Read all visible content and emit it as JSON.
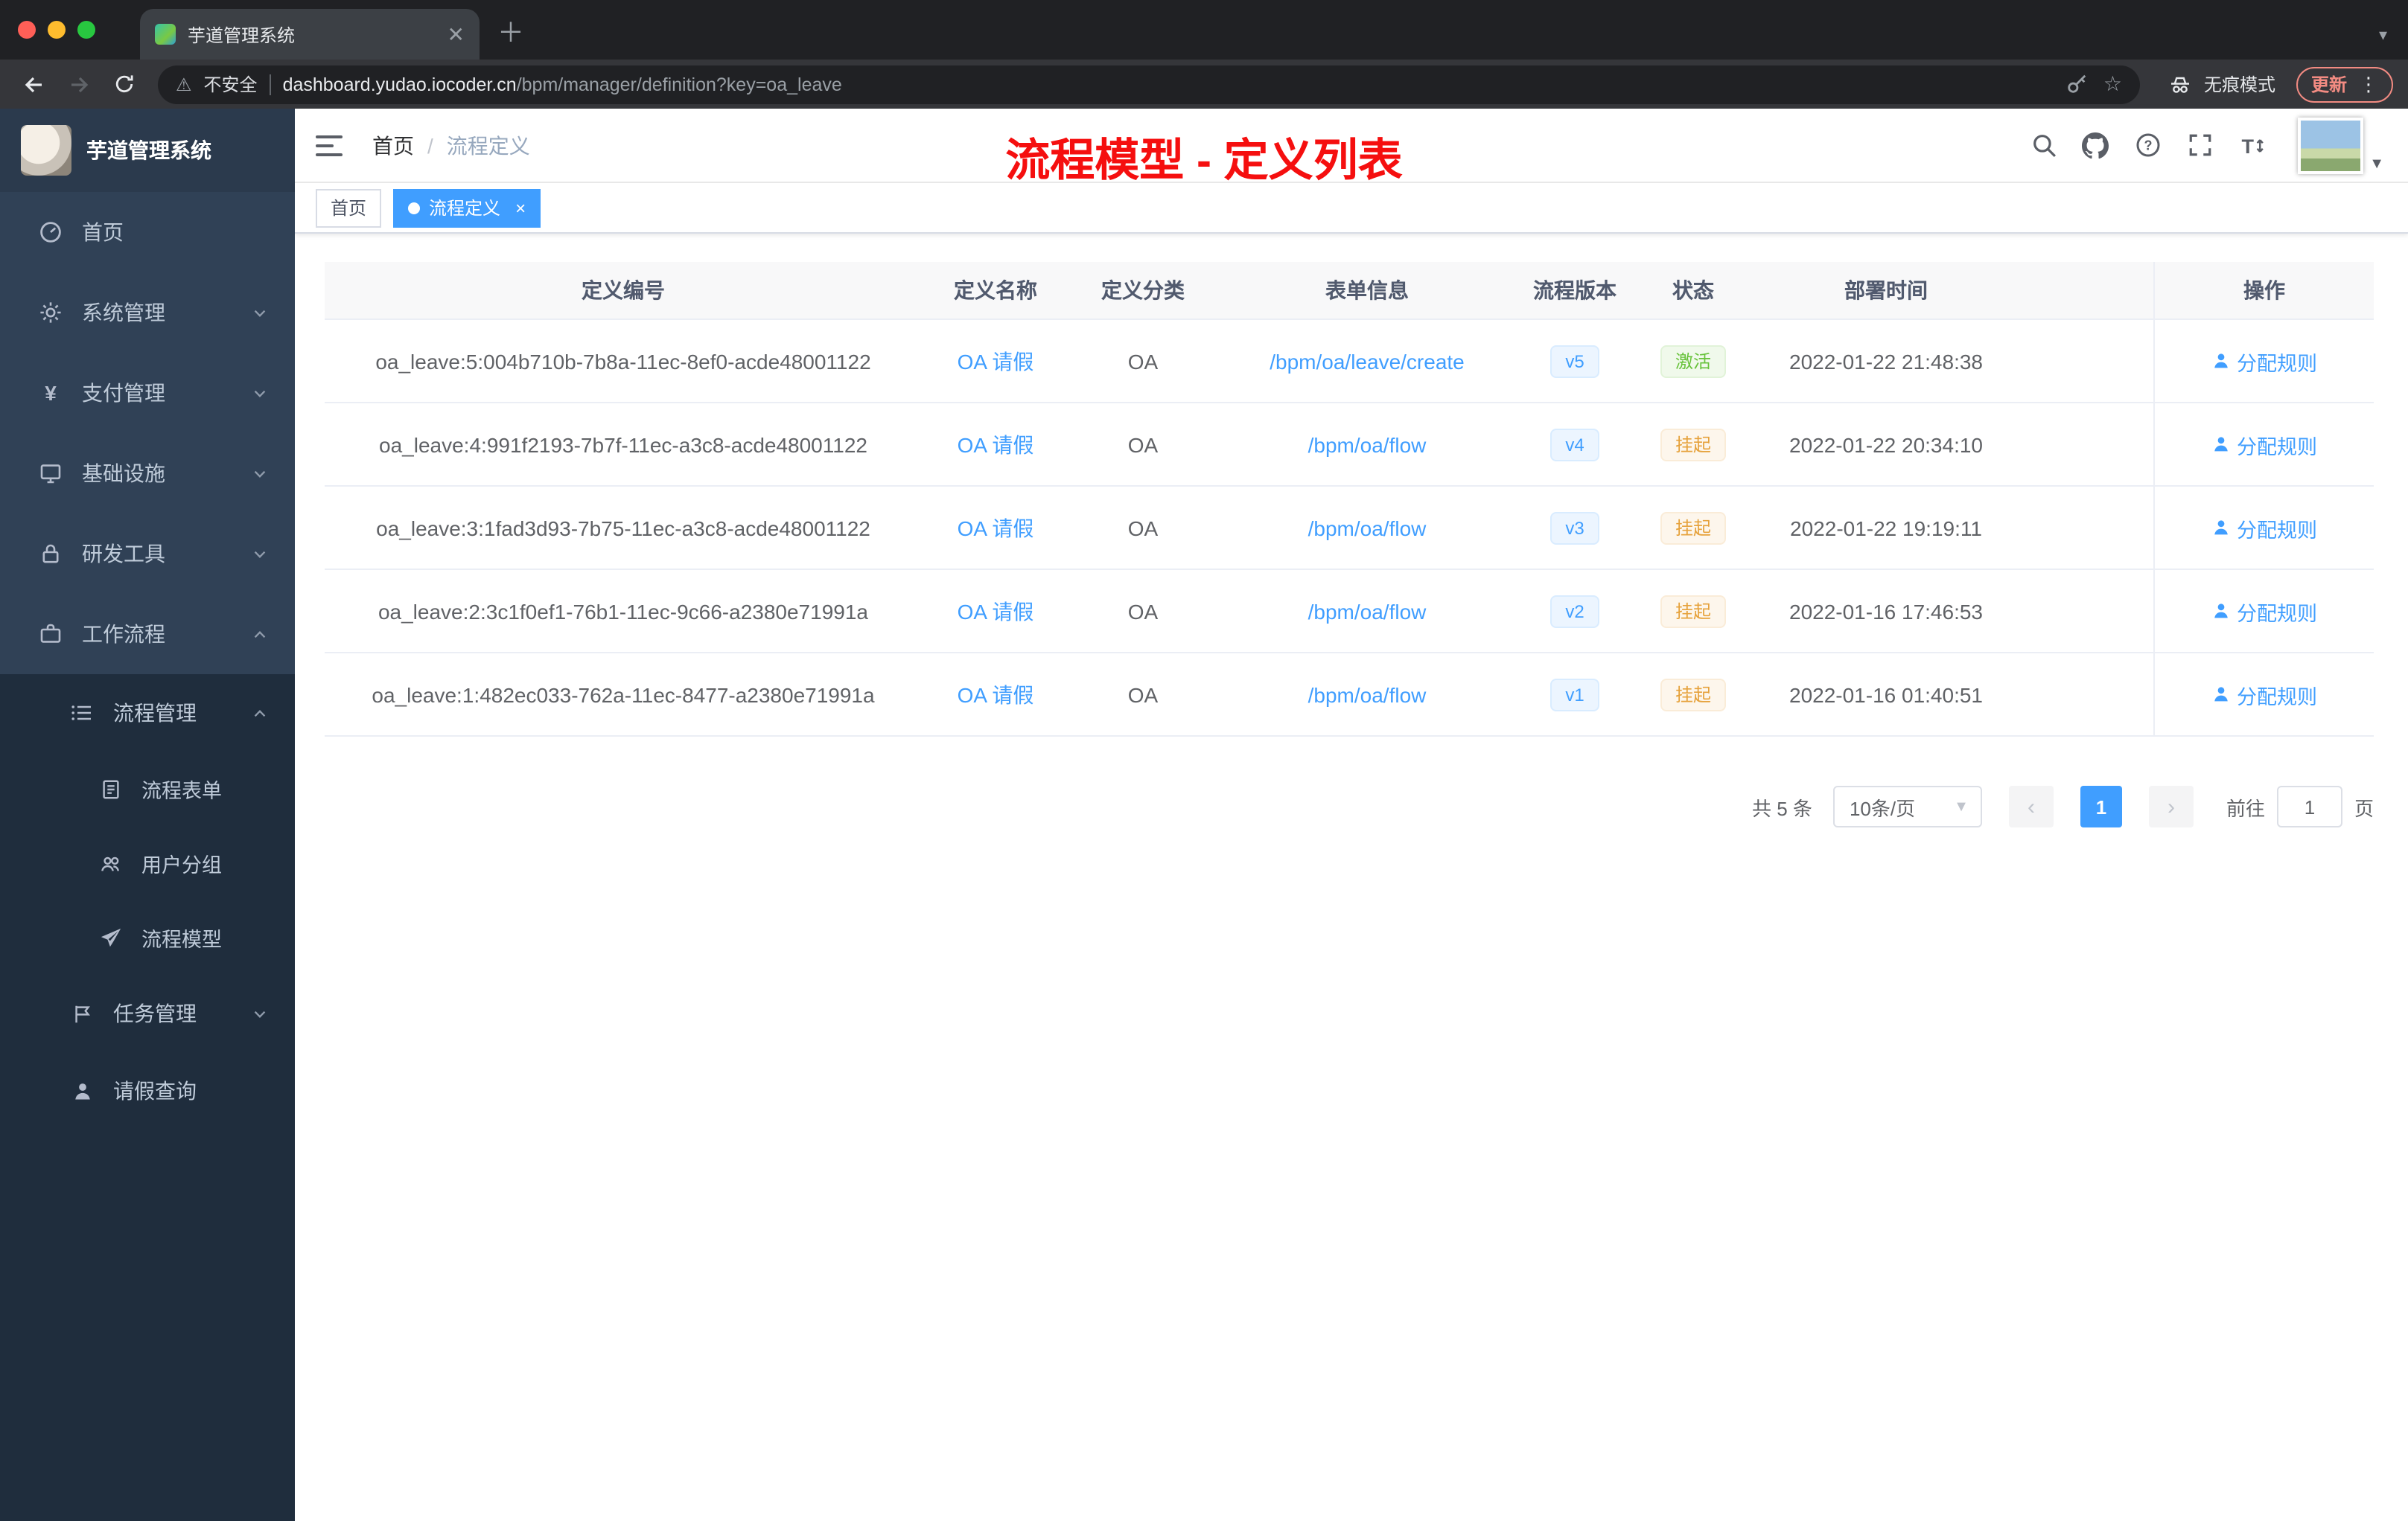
{
  "browser": {
    "tab_title": "芋道管理系统",
    "not_secure_label": "不安全",
    "url_host": "dashboard.yudao.iocoder.cn",
    "url_path": "/bpm/manager/definition?key=oa_leave",
    "incognito_label": "无痕模式",
    "update_label": "更新"
  },
  "sidebar": {
    "logo_title": "芋道管理系统",
    "items": [
      "首页",
      "系统管理",
      "支付管理",
      "基础设施",
      "研发工具",
      "工作流程"
    ],
    "workflow_items": [
      "流程管理",
      "任务管理",
      "请假查询"
    ],
    "process_items": [
      "流程表单",
      "用户分组",
      "流程模型"
    ]
  },
  "header": {
    "breadcrumb_home": "首页",
    "breadcrumb_sep": "/",
    "breadcrumb_current": "流程定义",
    "annotation": "流程模型 - 定义列表"
  },
  "tags": {
    "home": "首页",
    "active": "流程定义",
    "close": "×"
  },
  "table": {
    "columns": [
      "定义编号",
      "定义名称",
      "定义分类",
      "表单信息",
      "流程版本",
      "状态",
      "部署时间",
      "操作"
    ],
    "rows": [
      {
        "id": "oa_leave:5:004b710b-7b8a-11ec-8ef0-acde48001122",
        "name": "OA 请假",
        "category": "OA",
        "form": "/bpm/oa/leave/create",
        "version": "v5",
        "status": "激活",
        "status_type": "success",
        "deploy_time": "2022-01-22 21:48:38",
        "action": "分配规则"
      },
      {
        "id": "oa_leave:4:991f2193-7b7f-11ec-a3c8-acde48001122",
        "name": "OA 请假",
        "category": "OA",
        "form": "/bpm/oa/flow",
        "version": "v4",
        "status": "挂起",
        "status_type": "warning",
        "deploy_time": "2022-01-22 20:34:10",
        "action": "分配规则"
      },
      {
        "id": "oa_leave:3:1fad3d93-7b75-11ec-a3c8-acde48001122",
        "name": "OA 请假",
        "category": "OA",
        "form": "/bpm/oa/flow",
        "version": "v3",
        "status": "挂起",
        "status_type": "warning",
        "deploy_time": "2022-01-22 19:19:11",
        "action": "分配规则"
      },
      {
        "id": "oa_leave:2:3c1f0ef1-76b1-11ec-9c66-a2380e71991a",
        "name": "OA 请假",
        "category": "OA",
        "form": "/bpm/oa/flow",
        "version": "v2",
        "status": "挂起",
        "status_type": "warning",
        "deploy_time": "2022-01-16 17:46:53",
        "action": "分配规则"
      },
      {
        "id": "oa_leave:1:482ec033-762a-11ec-8477-a2380e71991a",
        "name": "OA 请假",
        "category": "OA",
        "form": "/bpm/oa/flow",
        "version": "v1",
        "status": "挂起",
        "status_type": "warning",
        "deploy_time": "2022-01-16 01:40:51",
        "action": "分配规则"
      }
    ]
  },
  "pagination": {
    "total": "共 5 条",
    "page_size": "10条/页",
    "prev": "‹",
    "page": "1",
    "next": "›",
    "goto_prefix": "前往",
    "goto_value": "1",
    "goto_suffix": "页"
  },
  "colors": {
    "accent": "#409eff",
    "success": "#67c23a",
    "warning": "#e6a23c",
    "sidebar_bg": "#304156",
    "submenu_bg": "#1f2d3d",
    "annotation_red": "#f50f0f",
    "update_orange": "#f28b82"
  }
}
